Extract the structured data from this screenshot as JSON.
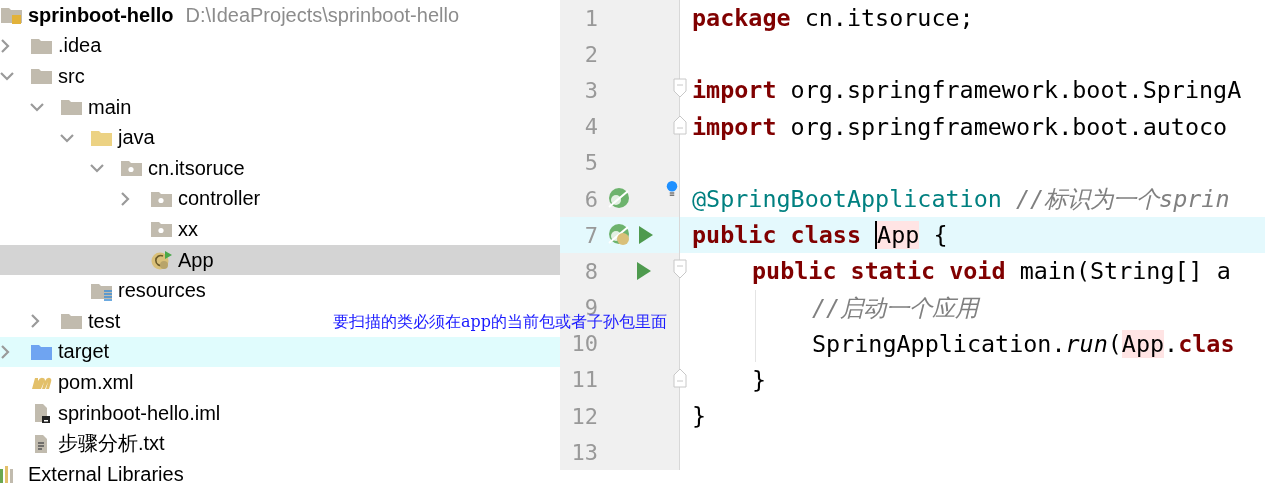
{
  "project_tree": [
    {
      "name": "sprinboot-hello",
      "path": "D:\\IdeaProjects\\sprinboot-hello",
      "kind": "module",
      "selected": false,
      "hovered": false,
      "children": [
        {
          "name": ".idea",
          "kind": "folder",
          "expanded": false,
          "selected": false,
          "hovered": false
        },
        {
          "name": "src",
          "kind": "folder",
          "expanded": true,
          "selected": false,
          "hovered": false,
          "children": [
            {
              "name": "main",
              "kind": "folder",
              "expanded": true,
              "selected": false,
              "hovered": false,
              "children": [
                {
                  "name": "java",
                  "kind": "source-folder",
                  "expanded": true,
                  "selected": false,
                  "hovered": false,
                  "children": [
                    {
                      "name": "cn.itsoruce",
                      "kind": "package",
                      "expanded": true,
                      "selected": false,
                      "hovered": false,
                      "children": [
                        {
                          "name": "controller",
                          "kind": "package",
                          "expanded": false,
                          "selected": false,
                          "hovered": false
                        },
                        {
                          "name": "xx",
                          "kind": "package",
                          "selected": false,
                          "hovered": false
                        },
                        {
                          "name": "App",
                          "kind": "spring-class",
                          "selected": true,
                          "hovered": false
                        }
                      ]
                    }
                  ]
                },
                {
                  "name": "resources",
                  "kind": "resources-folder",
                  "selected": false,
                  "hovered": false
                }
              ]
            },
            {
              "name": "test",
              "kind": "folder",
              "expanded": false,
              "selected": false,
              "hovered": false
            }
          ]
        },
        {
          "name": "target",
          "kind": "excluded-folder",
          "expanded": false,
          "selected": false,
          "hovered": true
        },
        {
          "name": "pom.xml",
          "kind": "maven",
          "selected": false,
          "hovered": false
        },
        {
          "name": "sprinboot-hello.iml",
          "kind": "iml",
          "selected": false,
          "hovered": false
        },
        {
          "name": "步骤分析.txt",
          "kind": "text-file",
          "selected": false,
          "hovered": false
        }
      ]
    },
    {
      "name": "External Libraries",
      "kind": "libraries",
      "selected": false,
      "hovered": false
    }
  ],
  "annotation": "要扫描的类必须在app的当前包或者子孙包里面",
  "editor": {
    "lines": [
      {
        "number": "1",
        "current": false,
        "bean": false,
        "run": false,
        "fold_start": false,
        "fold_end": false,
        "tokens": [
          {
            "text": "package",
            "kind": "keyword"
          },
          {
            "text": "cn.itsoruce;",
            "kind": "plain"
          }
        ]
      },
      {
        "number": "2",
        "current": false,
        "bean": false,
        "run": false,
        "fold_start": false,
        "fold_end": false
      },
      {
        "number": "3",
        "current": false,
        "bean": false,
        "run": false,
        "fold_start": true,
        "fold_end": false,
        "tokens": [
          {
            "text": "import",
            "kind": "keyword"
          },
          {
            "text": "org.springframework.boot.SpringA",
            "kind": "plain"
          }
        ]
      },
      {
        "number": "4",
        "current": false,
        "bean": false,
        "run": false,
        "fold_start": false,
        "fold_end": true,
        "tokens": [
          {
            "text": "import",
            "kind": "keyword"
          },
          {
            "text": "org.springframework.boot.autoco",
            "kind": "plain"
          }
        ]
      },
      {
        "number": "5",
        "current": false,
        "bean": false,
        "run": false,
        "fold_start": false,
        "fold_end": false
      },
      {
        "number": "6",
        "current": false,
        "bean": true,
        "run": false,
        "fold_start": false,
        "fold_end": false,
        "tokens": [
          {
            "text": "@SpringBootApplication",
            "kind": "annotation"
          },
          {
            "text": "//标识为一个sprin",
            "kind": "comment"
          }
        ]
      },
      {
        "number": "7",
        "current": true,
        "bean": true,
        "run": true,
        "fold_start": false,
        "fold_end": false,
        "tokens": [
          {
            "text": "public",
            "kind": "keyword"
          },
          {
            "text": "class",
            "kind": "keyword"
          },
          {
            "text": "App",
            "kind": "ref-caret"
          },
          {
            "text": "{",
            "kind": "plain"
          }
        ],
        "children": [
          {
            "number": "8",
            "current": false,
            "bean": false,
            "run": true,
            "fold_start": true,
            "fold_end": false,
            "tokens": [
              {
                "text": "public",
                "kind": "keyword"
              },
              {
                "text": "static",
                "kind": "keyword"
              },
              {
                "text": "void",
                "kind": "keyword"
              },
              {
                "text": "main(String[] a",
                "kind": "plain"
              }
            ],
            "children": [
              {
                "number": "9",
                "current": false,
                "bean": false,
                "run": false,
                "fold_start": false,
                "fold_end": false,
                "tokens": [
                  {
                    "text": "//启动一个应用",
                    "kind": "comment"
                  }
                ]
              },
              {
                "number": "10",
                "current": false,
                "bean": false,
                "run": false,
                "fold_start": false,
                "fold_end": false,
                "tokens": [
                  {
                    "text": "SpringApplication.",
                    "kind": "plain-tight"
                  },
                  {
                    "text": "run",
                    "kind": "static-call"
                  },
                  {
                    "text": "(",
                    "kind": "plain-tight"
                  },
                  {
                    "text": "App",
                    "kind": "ref"
                  },
                  {
                    "text": ".",
                    "kind": "plain-tight"
                  },
                  {
                    "text": "clas",
                    "kind": "keyword"
                  }
                ]
              }
            ]
          },
          {
            "number": "11",
            "current": false,
            "bean": false,
            "run": false,
            "fold_start": false,
            "fold_end": true,
            "tokens": [
              {
                "text": "}",
                "kind": "plain"
              }
            ]
          }
        ]
      },
      {
        "number": "12",
        "current": false,
        "bean": false,
        "run": false,
        "fold_start": false,
        "fold_end": false,
        "tokens": [
          {
            "text": "}",
            "kind": "plain"
          }
        ]
      },
      {
        "number": "13",
        "current": false,
        "bean": false,
        "run": false,
        "fold_start": false,
        "fold_end": false
      }
    ]
  }
}
